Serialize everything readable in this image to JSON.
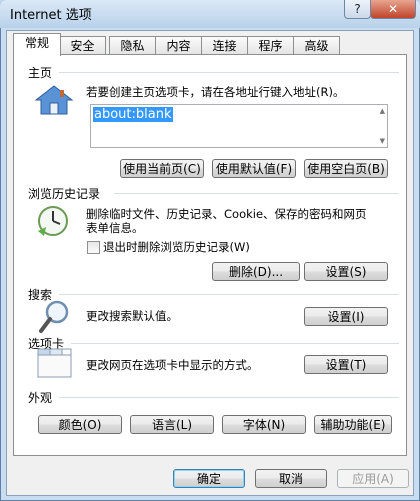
{
  "window": {
    "title": "Internet 选项",
    "help_glyph": "?",
    "close_glyph": "✕"
  },
  "tabs": [
    "常规",
    "安全",
    "隐私",
    "内容",
    "连接",
    "程序",
    "高级"
  ],
  "home": {
    "group_title": "主页",
    "description": "若要创建主页选项卡，请在各地址行键入地址(R)。",
    "url": "about:blank",
    "buttons": [
      "使用当前页(C)",
      "使用默认值(F)",
      "使用空白页(B)"
    ]
  },
  "history": {
    "group_title": "浏览历史记录",
    "description_line1": "删除临时文件、历史记录、Cookie、保存的密码和网页",
    "description_line2": "表单信息。",
    "checkbox_label": "退出时删除浏览历史记录(W)",
    "delete_button": "删除(D)...",
    "settings_button": "设置(S)"
  },
  "search": {
    "group_title": "搜索",
    "description": "更改搜索默认值。",
    "settings_button": "设置(I)"
  },
  "tabs_group": {
    "group_title": "选项卡",
    "description": "更改网页在选项卡中显示的方式。",
    "settings_button": "设置(T)"
  },
  "appearance": {
    "group_title": "外观",
    "buttons": [
      "颜色(O)",
      "语言(L)",
      "字体(N)",
      "辅助功能(E)"
    ]
  },
  "dialog_buttons": {
    "ok": "确定",
    "cancel": "取消",
    "apply": "应用(A)"
  }
}
